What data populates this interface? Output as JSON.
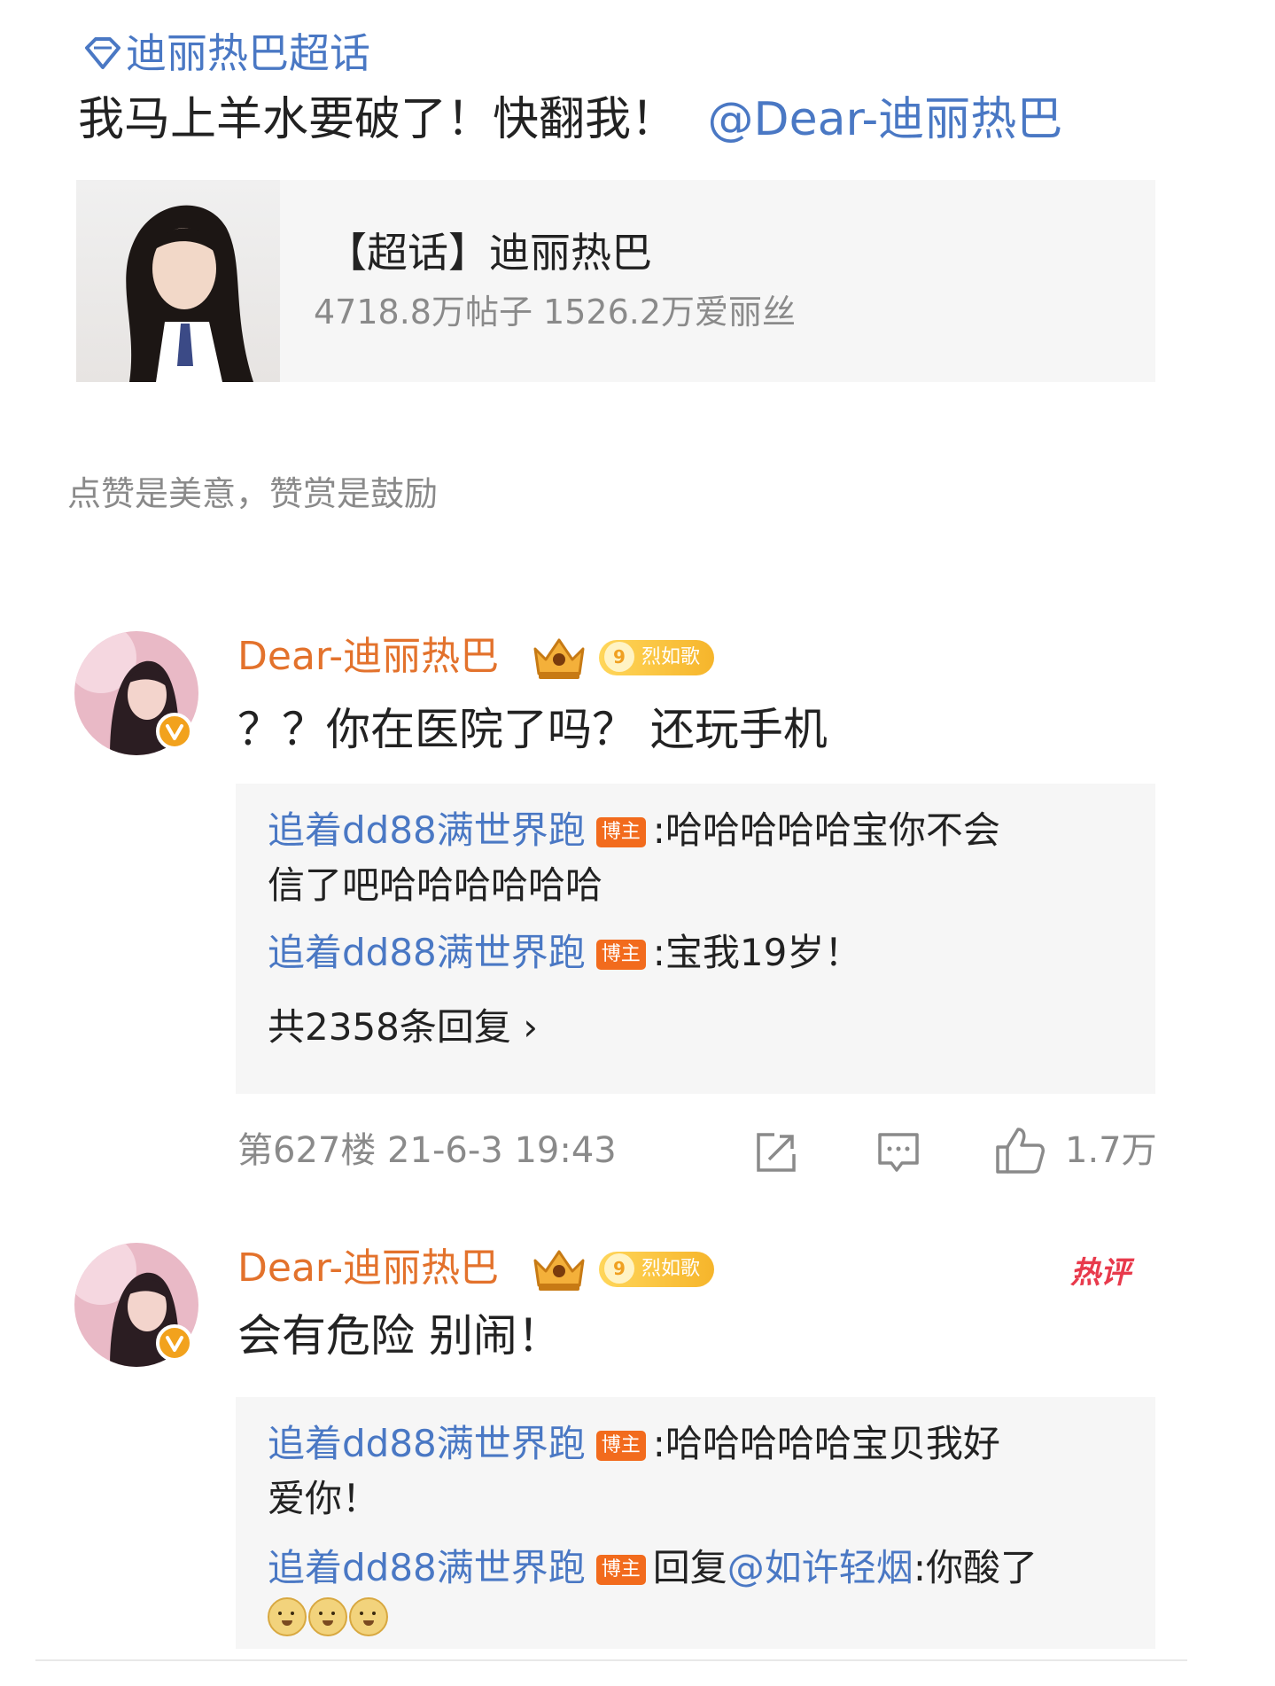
{
  "post": {
    "topic_tag": "迪丽热巴超话",
    "text": "我马上羊水要破了！快翻我！",
    "mention": "@Dear-迪丽热巴"
  },
  "topic_card": {
    "title": "【超话】迪丽热巴",
    "stats": "4718.8万帖子 1526.2万爱丽丝"
  },
  "encourage_text": "点赞是美意，赞赏是鼓励",
  "comments": [
    {
      "username": "Dear-迪丽热巴",
      "level_number": "9",
      "level_label": "烈如歌",
      "text": "？？你在医院了吗？ 还玩手机",
      "replies": [
        {
          "user": "追着dd88满世界跑",
          "tag": "博主",
          "line1": ":哈哈哈哈哈宝你不会",
          "line2": "信了吧哈哈哈哈哈哈"
        },
        {
          "user": "追着dd88满世界跑",
          "tag": "博主",
          "line1": ":宝我19岁！"
        }
      ],
      "reply_count": "共2358条回复 ›",
      "floor_time": "第627楼 21-6-3 19:43",
      "likes": "1.7万"
    },
    {
      "username": "Dear-迪丽热巴",
      "level_number": "9",
      "level_label": "烈如歌",
      "hot_label": "热评",
      "text": "会有危险 别闹！",
      "replies": [
        {
          "user": "追着dd88满世界跑",
          "tag": "博主",
          "line1": ":哈哈哈哈哈宝贝我好",
          "line2": "爱你！"
        },
        {
          "user": "追着dd88满世界跑",
          "tag": "博主",
          "prefix": "回复",
          "mention": "@如许轻烟",
          "line1": ":你酸了"
        }
      ]
    }
  ]
}
